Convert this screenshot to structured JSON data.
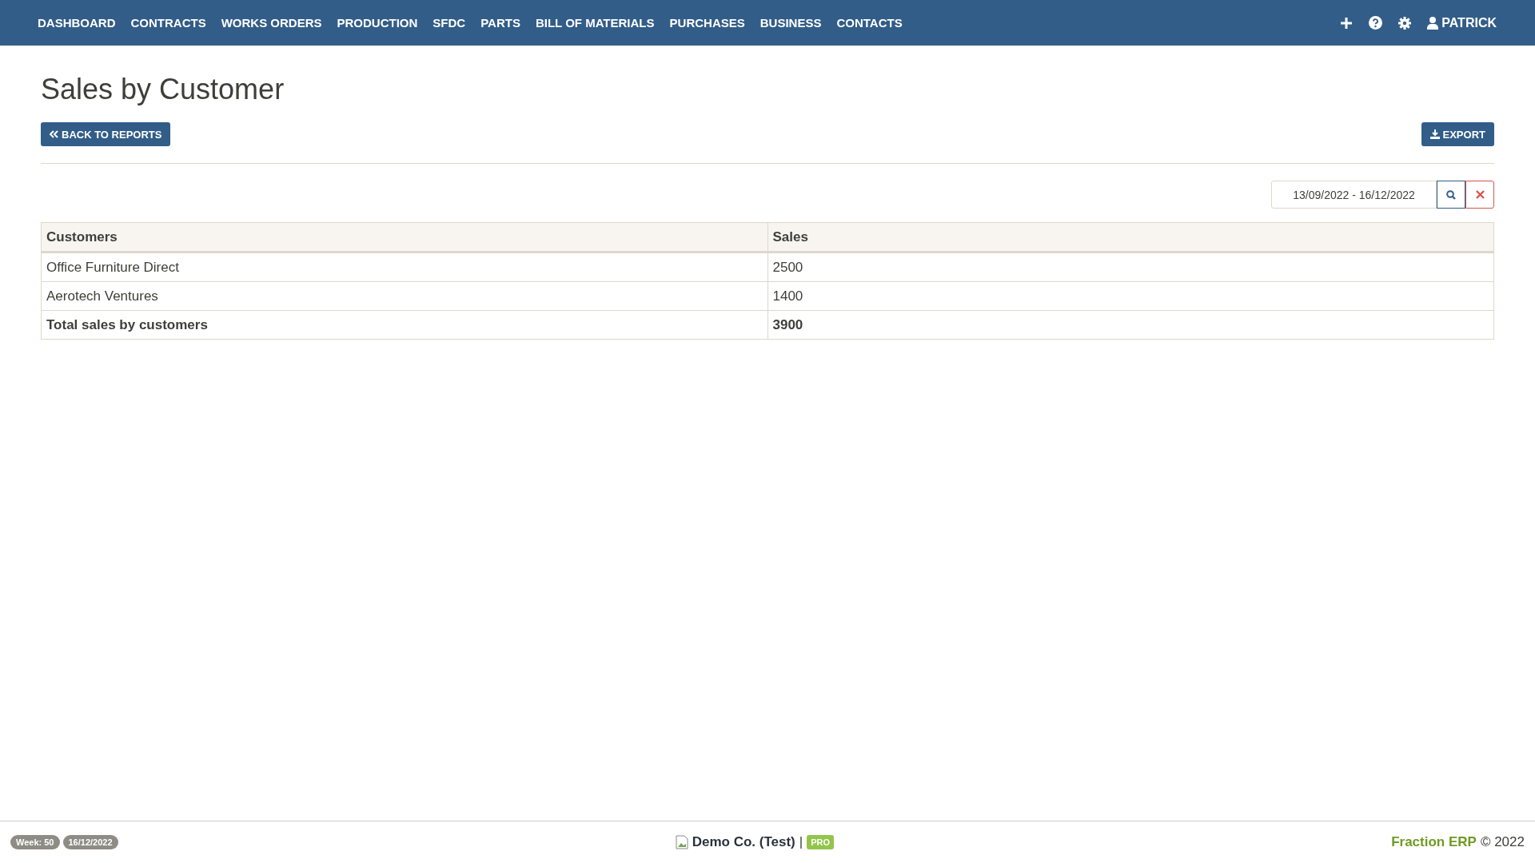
{
  "nav": {
    "items": [
      "DASHBOARD",
      "CONTRACTS",
      "WORKS ORDERS",
      "PRODUCTION",
      "SFDC",
      "PARTS",
      "BILL OF MATERIALS",
      "PURCHASES",
      "BUSINESS",
      "CONTACTS"
    ],
    "user": "PATRICK"
  },
  "page": {
    "title": "Sales by Customer",
    "back_button": "BACK TO REPORTS",
    "export_button": "EXPORT"
  },
  "date_filter": {
    "value": "13/09/2022 - 16/12/2022"
  },
  "table": {
    "columns": [
      "Customers",
      "Sales"
    ],
    "rows": [
      {
        "cells": [
          "Office Furniture Direct",
          "2500"
        ],
        "kind": "data"
      },
      {
        "cells": [
          "Aerotech Ventures",
          "1400"
        ],
        "kind": "data"
      },
      {
        "cells": [
          "Total sales by customers",
          "3900"
        ],
        "kind": "total"
      }
    ]
  },
  "footer": {
    "week": "Week: 50",
    "date": "16/12/2022",
    "company": "Demo Co. (Test)",
    "separator": "|",
    "plan": "PRO",
    "brand": "Fraction ERP",
    "copyright": "© 2022"
  }
}
